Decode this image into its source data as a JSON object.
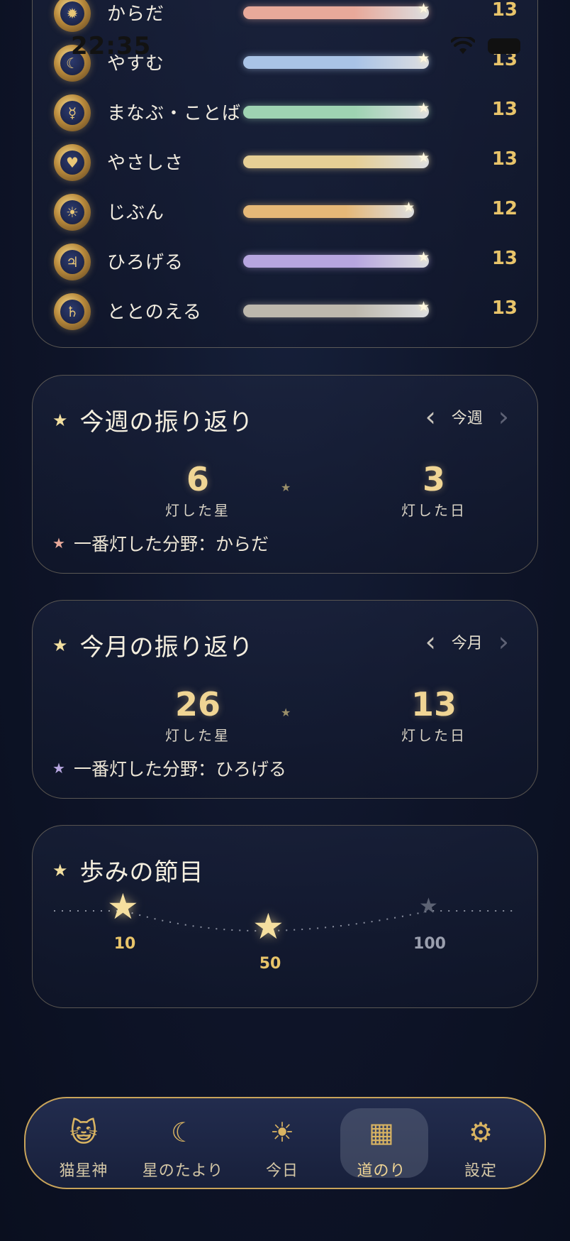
{
  "status_bar": {
    "time": "22:35"
  },
  "categories": [
    {
      "label": "からだ",
      "count": "13",
      "progress": 1.0,
      "color": "#e8a99a",
      "icon": "flame-medal-icon",
      "glyph": "✹"
    },
    {
      "label": "やすむ",
      "count": "13",
      "progress": 1.0,
      "color": "#a9c3e6",
      "icon": "moon-medal-icon",
      "glyph": "☾"
    },
    {
      "label": "まなぶ・ことば",
      "count": "13",
      "progress": 1.0,
      "color": "#9ed3b2",
      "icon": "mercury-medal-icon",
      "glyph": "☿"
    },
    {
      "label": "やさしさ",
      "count": "13",
      "progress": 1.0,
      "color": "#e6cf95",
      "icon": "heart-medal-icon",
      "glyph": "♥"
    },
    {
      "label": "じぶん",
      "count": "12",
      "progress": 0.92,
      "color": "#e6b877",
      "icon": "sun-medal-icon",
      "glyph": "☀"
    },
    {
      "label": "ひろげる",
      "count": "13",
      "progress": 1.0,
      "color": "#b7a6e0",
      "icon": "jupiter-medal-icon",
      "glyph": "♃"
    },
    {
      "label": "ととのえる",
      "count": "13",
      "progress": 1.0,
      "color": "#bdb8ad",
      "icon": "saturn-medal-icon",
      "glyph": "♄"
    }
  ],
  "weekly": {
    "title": "今週の振り返り",
    "period": "今週",
    "stars": "6",
    "stars_caption": "灯した星",
    "days": "3",
    "days_caption": "灯した日",
    "best_field": "一番灯した分野：からだ",
    "best_color": "#e8a99a"
  },
  "monthly": {
    "title": "今月の振り返り",
    "period": "今月",
    "stars": "26",
    "stars_caption": "灯した星",
    "days": "13",
    "days_caption": "灯した日",
    "best_field": "一番灯した分野：ひろげる",
    "best_color": "#b7a6e0"
  },
  "milestones": {
    "title": "歩みの節目",
    "items": [
      {
        "label": "10",
        "achieved": true
      },
      {
        "label": "50",
        "achieved": true
      },
      {
        "label": "100",
        "achieved": false
      }
    ]
  },
  "tabs": [
    {
      "label": "猫星神",
      "icon": "cat-medal-icon",
      "glyph": "😺",
      "active": false
    },
    {
      "label": "星のたより",
      "icon": "crescent-moon-icon",
      "glyph": "☾",
      "active": false
    },
    {
      "label": "今日",
      "icon": "sun-icon",
      "glyph": "☀",
      "active": false
    },
    {
      "label": "道のり",
      "icon": "calendar-icon",
      "glyph": "▦",
      "active": true
    },
    {
      "label": "設定",
      "icon": "gear-icon",
      "glyph": "⚙",
      "active": false
    }
  ]
}
